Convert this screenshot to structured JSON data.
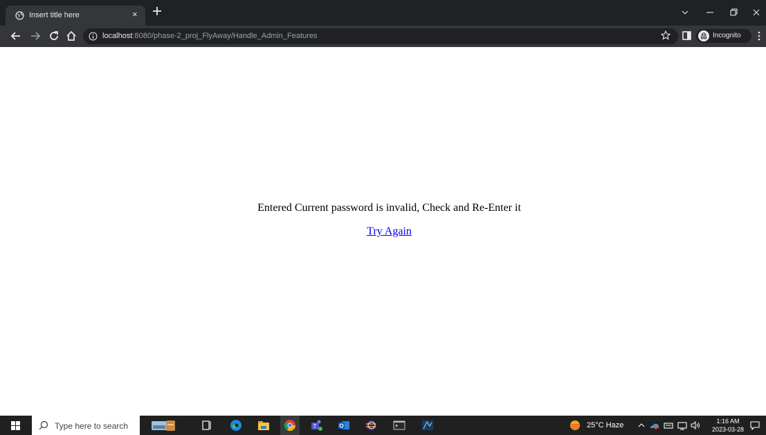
{
  "browser": {
    "tab": {
      "title": "Insert title here",
      "close_glyph": "×"
    },
    "new_tab_icon": "plus-icon",
    "window_controls": [
      "chevron-down-icon",
      "minimize-icon",
      "restore-icon",
      "close-icon"
    ],
    "nav": [
      "back-arrow-icon",
      "forward-arrow-icon",
      "reload-icon",
      "home-icon"
    ],
    "url_host": "localhost",
    "url_rest": ":8080/phase-2_proj_FlyAway/Handle_Admin_Features",
    "incognito_label": "Incognito"
  },
  "page": {
    "message": "Entered Current password is invalid, Check and Re-Enter it",
    "link_text": "Try Again"
  },
  "taskbar": {
    "search_placeholder": "Type here to search",
    "weather": "25°C  Haze",
    "time": "1:16 AM",
    "date": "2023-03-28"
  },
  "colors": {
    "chrome_dark": "#202124",
    "toolbar": "#35363a",
    "link": "#0000ee",
    "taskbar": "#202020"
  }
}
